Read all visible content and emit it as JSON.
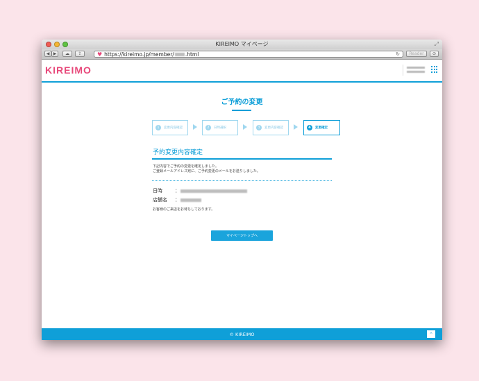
{
  "browser": {
    "window_title": "KIREIMO マイページ",
    "url_prefix": "https://kireimo.jp/member/",
    "url_suffix": ".html",
    "reader_label": "Reader"
  },
  "site": {
    "logo": "KIREIMO",
    "footer_text": "© KIREIMO",
    "brand_color": "#0f9fd8",
    "accent_color": "#e8487a"
  },
  "page": {
    "title": "ご予約の変更",
    "steps": [
      {
        "num": "1",
        "label": "変更内容確認"
      },
      {
        "num": "2",
        "label": "日時選択"
      },
      {
        "num": "3",
        "label": "変更内容確認"
      },
      {
        "num": "4",
        "label": "変更確定"
      }
    ],
    "section_title": "予約変更内容確定",
    "notice_line1": "下記内容でご予約の変更を確定しました。",
    "notice_line2": "ご登録メールアドレス宛に、ご予約変更のメールをお送りしました。",
    "datetime_label": "日時",
    "shop_label": "店舗名",
    "colon": "：",
    "thanks": "お客様のご来店をお待ちしております。",
    "mypage_button": "マイページトップへ"
  }
}
